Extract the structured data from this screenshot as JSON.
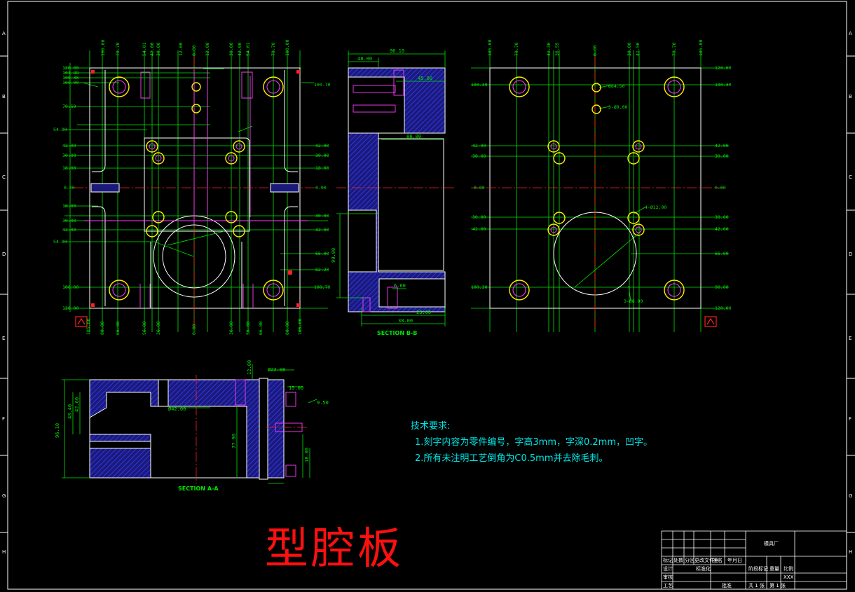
{
  "title": "型腔板",
  "notes": {
    "heading": "技术要求:",
    "items": [
      "1.刻字内容为零件编号，字高3mm，字深0.2mm，凹字。",
      "2.所有未注明工艺倒角为C0.5mm并去除毛刺。"
    ]
  },
  "zone_rows": [
    "A",
    "B",
    "C",
    "D",
    "E",
    "F",
    "G",
    "H"
  ],
  "section_labels": {
    "aa": "SECTION A-A",
    "bb": "SECTION B-B"
  },
  "front_view": {
    "left_dims": [
      "120.00",
      "101.88",
      "100.36",
      "100.00",
      "79.50",
      "54.00",
      "42.00",
      "30.00",
      "18.00",
      "0.00",
      "18.00",
      "30.00",
      "42.00",
      "54.00",
      "100.00",
      "120.00"
    ],
    "right_dims": [
      "100.70",
      "42.00",
      "30.00",
      "18.00",
      "0.00",
      "30.00",
      "42.00",
      "66.00",
      "82.20",
      "100.70"
    ],
    "top_dims": [
      "100.00",
      "79.70",
      "54.01",
      "42.00",
      "30.00",
      "12.00",
      "0.00",
      "12.00",
      "30.00",
      "42.00",
      "54.01",
      "79.70",
      "100.00"
    ],
    "bottom_dims": [
      "105.00",
      "80.00",
      "66.00",
      "56.00",
      "36.00",
      "0.00",
      "36.00",
      "56.00",
      "66.00",
      "80.00",
      "105.00"
    ]
  },
  "section_bb_dims": [
    "48.00",
    "96.10",
    "45.00",
    "88.00",
    "99.00",
    "6.60",
    "23.00",
    "38.00"
  ],
  "right_view": {
    "left_dims": [
      "100.30",
      "42.00",
      "30.00",
      "0.00",
      "30.00",
      "42.00",
      "100.30"
    ],
    "right_dims": [
      "120.00",
      "100.30",
      "42.00",
      "30.00",
      "0.00",
      "30.00",
      "42.00",
      "66.00",
      "90.00",
      "120.00"
    ],
    "top_dims": [
      "105.00",
      "79.70",
      "41.30",
      "36.55",
      "0.00",
      "30.00",
      "41.50",
      "79.70",
      "105.00"
    ],
    "callouts": [
      "4-Ø12.00",
      "3-Ø6.00",
      "Ø84.50",
      "3-Ø9.00"
    ]
  },
  "section_aa_dims": [
    "96.10",
    "48.40",
    "42.60",
    "77.90",
    "Ø42.00",
    "Ø22.00",
    "15.00",
    "18.00",
    "12.00",
    "9.50"
  ],
  "title_block": {
    "cells": [
      "标记",
      "处数",
      "分区",
      "更改文件号",
      "签名",
      "年月日",
      "设计",
      "标准化",
      "阶段标记",
      "重量",
      "比例",
      "审核",
      "工艺",
      "批准",
      "共 1 张",
      "第 1 张",
      "XXX",
      "模具厂"
    ]
  },
  "colors": {
    "background": "#000000",
    "frame": "#ffffff",
    "dimension": "#00e600",
    "center_line": "#ff2020",
    "hidden_line": "#ff3cff",
    "hatch": "#2a2aff",
    "hole": "#ffee00",
    "notes": "#00e6e6",
    "title": "#ff1010"
  }
}
